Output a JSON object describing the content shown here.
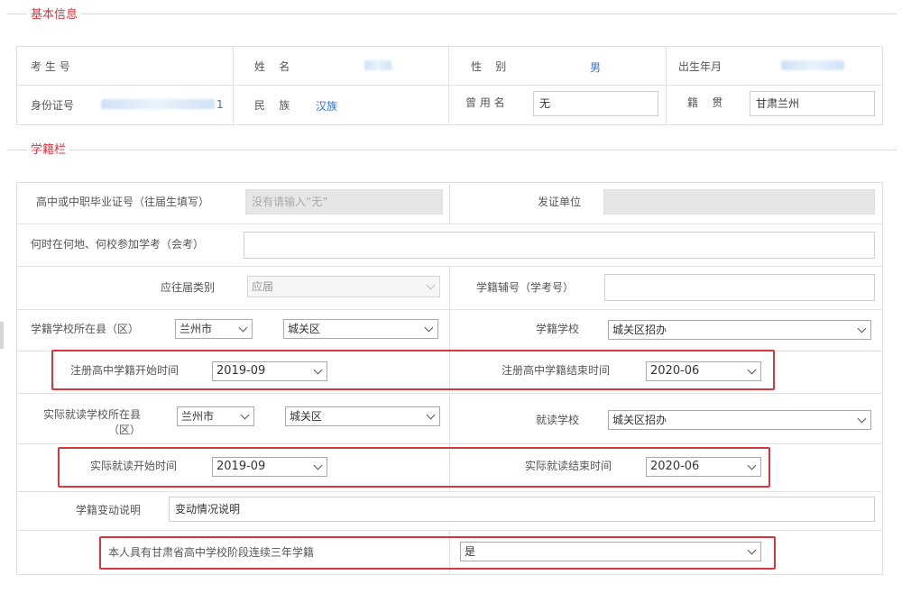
{
  "basic_info": {
    "legend": "基本信息",
    "exam_no_label": "考 生 号",
    "name_label": "姓    名",
    "gender_label": "性    别",
    "gender_value": "男",
    "birth_label": "出生年月",
    "id_label": "身份证号",
    "id_tail": "1",
    "ethnicity_label": "民    族",
    "ethnicity_value": "汉族",
    "former_name_label": "曾 用 名",
    "former_name_value": "无",
    "native_label": "籍    贯",
    "native_value": "甘肃兰州"
  },
  "enrollment": {
    "legend": "学籍栏",
    "grad_cert_label": "高中或中职毕业证号（往届生填写）",
    "grad_cert_placeholder": "没有请输入“无”",
    "issuer_label": "发证单位",
    "exam_time_label": "何时在何地、何校参加学考（会考）",
    "student_type_label": "应往届类别",
    "student_type_value": "应届",
    "aux_no_label": "学籍辅号（学考号）",
    "school_county_label": "学籍学校所在县（区）",
    "school_city": "兰州市",
    "school_district": "城关区",
    "school_label": "学籍学校",
    "school_value": "城关区招办",
    "reg_start_label": "注册高中学籍开始时间",
    "reg_start_value": "2019-09",
    "reg_end_label": "注册高中学籍结束时间",
    "reg_end_value": "2020-06",
    "actual_county_label_1": "实际就读学校所在县",
    "actual_county_label_2": "（区）",
    "actual_city": "兰州市",
    "actual_district": "城关区",
    "actual_school_label": "就读学校",
    "actual_school_value": "城关区招办",
    "actual_start_label": "实际就读开始时间",
    "actual_start_value": "2019-09",
    "actual_end_label": "实际就读结束时间",
    "actual_end_value": "2020-06",
    "change_label": "学籍变动说明",
    "change_value": "变动情况说明",
    "three_year_label": "本人具有甘肃省高中学校阶段连续三年学籍",
    "three_year_value": "是"
  },
  "colors": {
    "legend_red": "#d9363e",
    "link_blue": "#2f6fd6",
    "highlight_red": "#d9363e"
  }
}
